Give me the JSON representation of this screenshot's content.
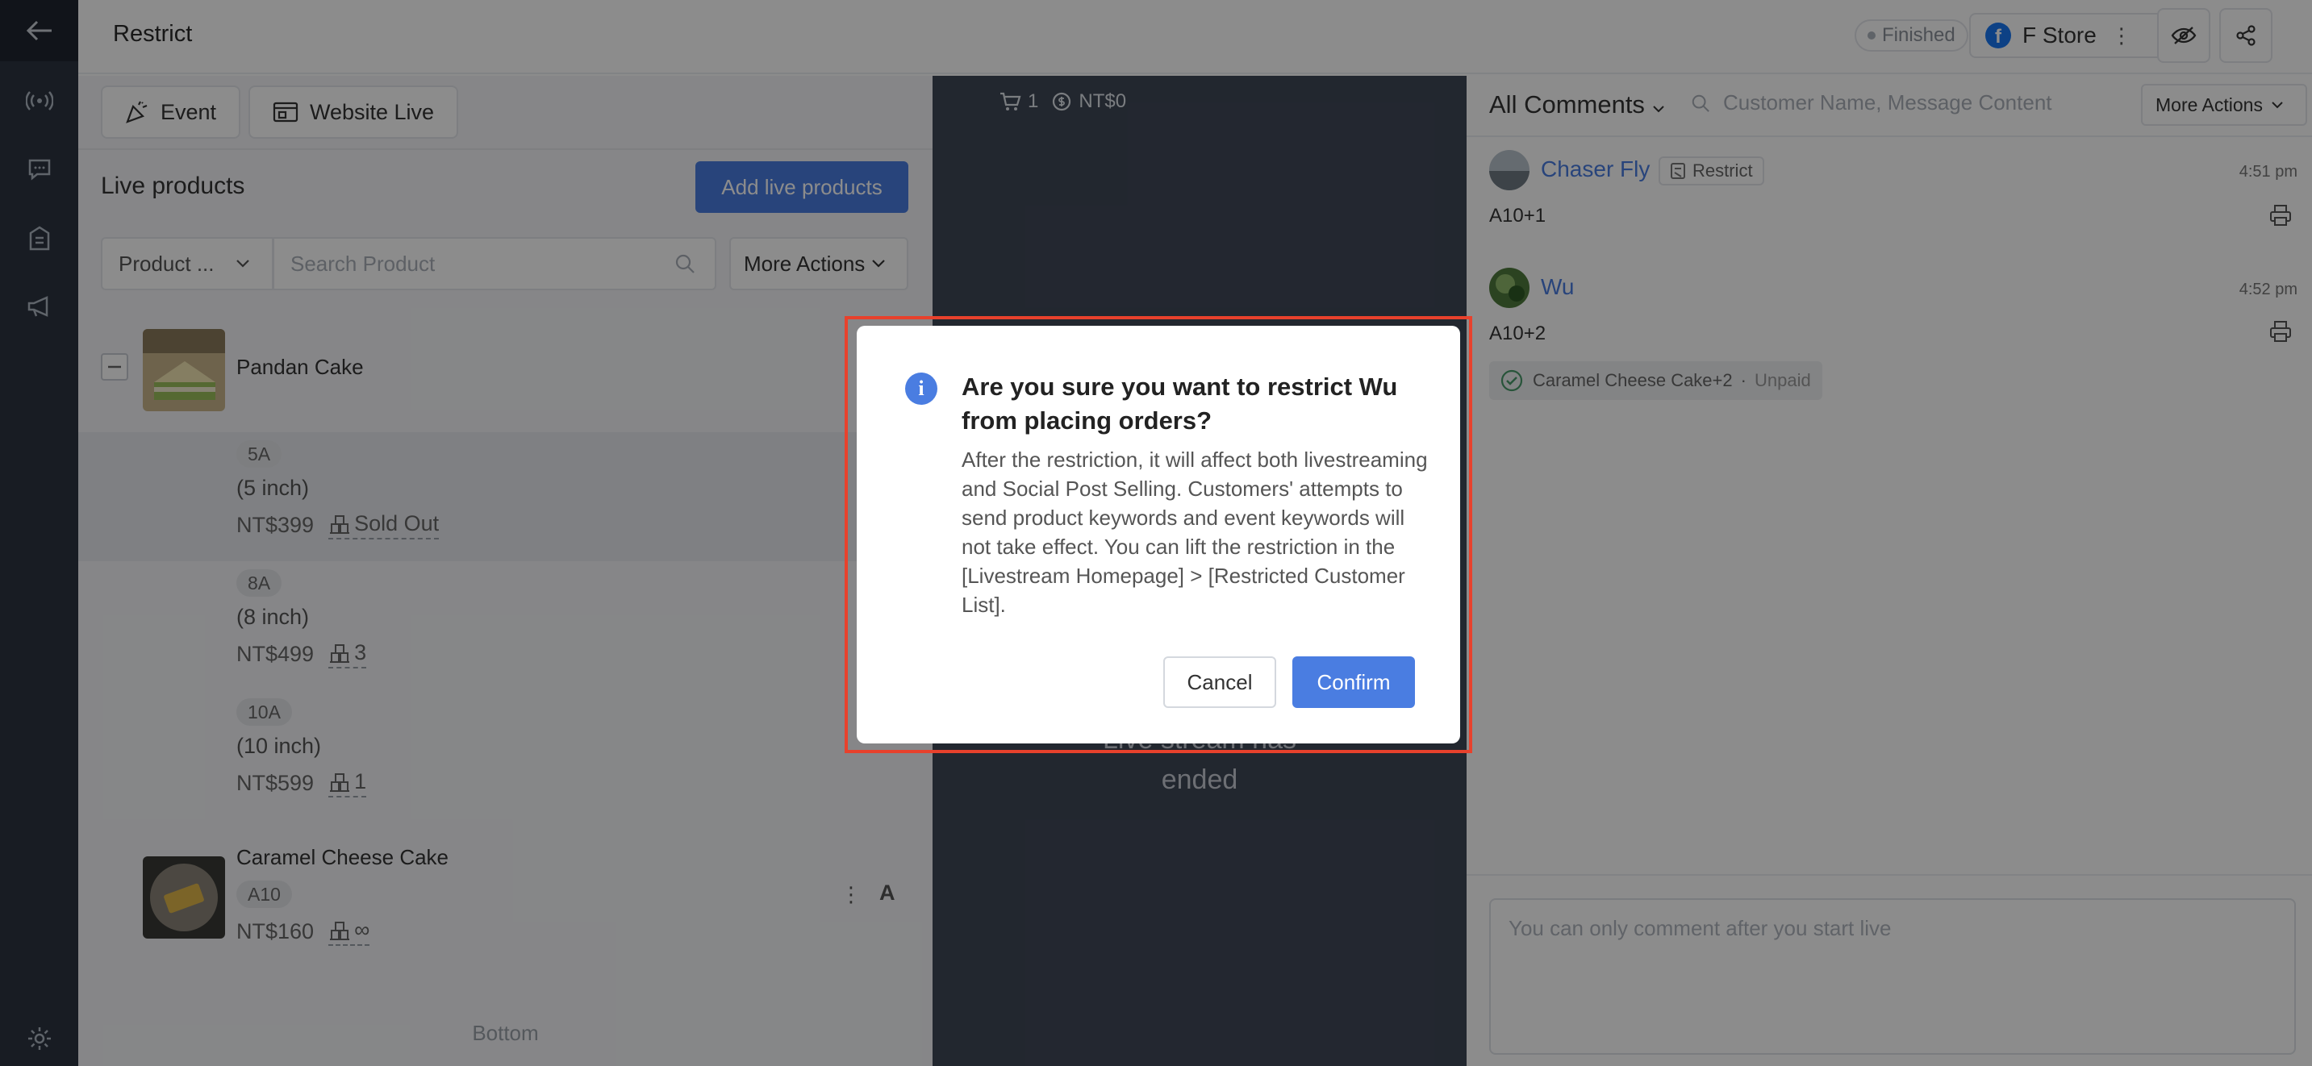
{
  "header": {
    "title": "Restrict",
    "status": "Finished",
    "store_name": "F Store",
    "brand_color": "#4a7de1"
  },
  "left_panel": {
    "tabs": [
      {
        "label": "Event",
        "icon": "party-popper-icon"
      },
      {
        "label": "Website Live",
        "icon": "browser-window-icon"
      }
    ],
    "title": "Live products",
    "add_button": "Add live products",
    "filter_select": "Product ...",
    "search_placeholder": "Search Product",
    "more_actions": "More Actions",
    "products": [
      {
        "name": "Pandan Cake",
        "variants": [
          {
            "tag": "5A",
            "size": "(5 inch)",
            "price": "NT$399",
            "stock": "Sold Out"
          },
          {
            "tag": "8A",
            "size": "(8 inch)",
            "price": "NT$499",
            "stock": "3"
          },
          {
            "tag": "10A",
            "size": "(10 inch)",
            "price": "NT$599",
            "stock": "1"
          }
        ]
      },
      {
        "name": "Caramel Cheese Cake",
        "tag": "A10",
        "price": "NT$160",
        "stock": "∞",
        "action_letter": "A"
      }
    ],
    "bottom": "Bottom"
  },
  "center": {
    "cart_count": "1",
    "amount": "NT$0",
    "ended_line1": "Live stream has",
    "ended_line2": "ended"
  },
  "right_panel": {
    "filter": "All Comments",
    "search_placeholder": "Customer Name, Message Content",
    "more_actions": "More Actions",
    "comments": [
      {
        "name": "Chaser Fly",
        "tag": "Restrict",
        "time": "4:51 pm",
        "text": "A10+1"
      },
      {
        "name": "Wu",
        "time": "4:52 pm",
        "text": "A10+2",
        "order": "Caramel Cheese Cake+2",
        "order_sep": "·",
        "order_status": "Unpaid"
      }
    ],
    "comment_placeholder": "You can only comment after you start live"
  },
  "modal": {
    "title": "Are you sure you want to restrict Wu from placing orders?",
    "body": "After the restriction, it will affect both livestreaming and Social Post Selling. Customers' attempts to send product keywords and event keywords will not take effect. You can lift the restriction in the [Livestream Homepage] > [Restricted Customer List].",
    "cancel": "Cancel",
    "confirm": "Confirm",
    "info_glyph": "i"
  }
}
